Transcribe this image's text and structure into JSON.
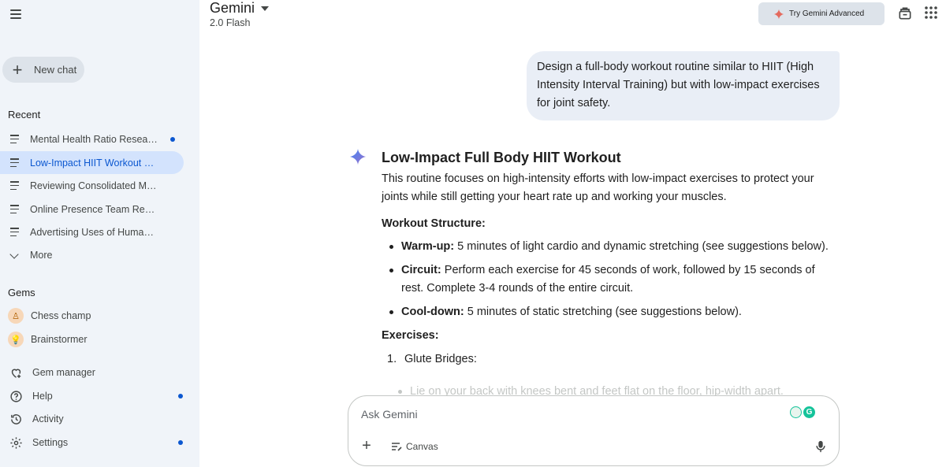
{
  "header": {
    "title": "Gemini",
    "model": "2.0 Flash",
    "try_advanced_label": "Try Gemini Advanced"
  },
  "sidebar": {
    "new_chat_label": "New chat",
    "recent_title": "Recent",
    "recent_items": [
      {
        "label": "Mental Health Ratio Research",
        "dot": true,
        "active": false
      },
      {
        "label": "Low-Impact HIIT Workout Design",
        "dot": false,
        "active": true
      },
      {
        "label": "Reviewing Consolidated Meeting",
        "dot": false,
        "active": false
      },
      {
        "label": "Online Presence Team Research",
        "dot": false,
        "active": false
      },
      {
        "label": "Advertising Uses of Human Data",
        "dot": false,
        "active": false
      }
    ],
    "more_label": "More",
    "gems_title": "Gems",
    "gems": [
      {
        "label": "Chess champ",
        "icon": "pawn-icon"
      },
      {
        "label": "Brainstormer",
        "icon": "lightbulb-icon"
      }
    ],
    "bottom_items": [
      {
        "label": "Gem manager",
        "icon": "gem-manager-icon",
        "dot": false
      },
      {
        "label": "Help",
        "icon": "help-icon",
        "dot": true
      },
      {
        "label": "Activity",
        "icon": "activity-icon",
        "dot": false
      },
      {
        "label": "Settings",
        "icon": "settings-icon",
        "dot": true
      }
    ]
  },
  "chat": {
    "user_message": "Design a full-body workout routine similar to HIIT (High Intensity Interval Training) but with low-impact exercises for joint safety.",
    "response": {
      "title": "Low-Impact Full Body HIIT Workout",
      "intro": "This routine focuses on high-intensity efforts with low-impact exercises to protect your joints while still getting your heart rate up and working your muscles.",
      "structure_heading": "Workout Structure:",
      "structure": [
        {
          "bold": "Warm-up:",
          "text": " 5 minutes of light cardio and dynamic stretching (see suggestions below)."
        },
        {
          "bold": "Circuit:",
          "text": " Perform each exercise for 45 seconds of work, followed by 15 seconds of rest. Complete 3-4 rounds of the entire circuit."
        },
        {
          "bold": "Cool-down:",
          "text": " 5 minutes of static stretching (see suggestions below)."
        }
      ],
      "exercises_heading": "Exercises:",
      "exercise_1_num": "1.",
      "exercise_1_title": "Glute Bridges:",
      "exercise_1_detail": "Lie on your back with knees bent and feet flat on the floor, hip-width apart."
    }
  },
  "input": {
    "placeholder": "Ask Gemini",
    "canvas_label": "Canvas"
  },
  "colors": {
    "sidebar_bg": "#f0f4f9",
    "active_item_bg": "#d3e3fd",
    "accent": "#0b57d0",
    "user_bubble_bg": "#e9eef6"
  }
}
